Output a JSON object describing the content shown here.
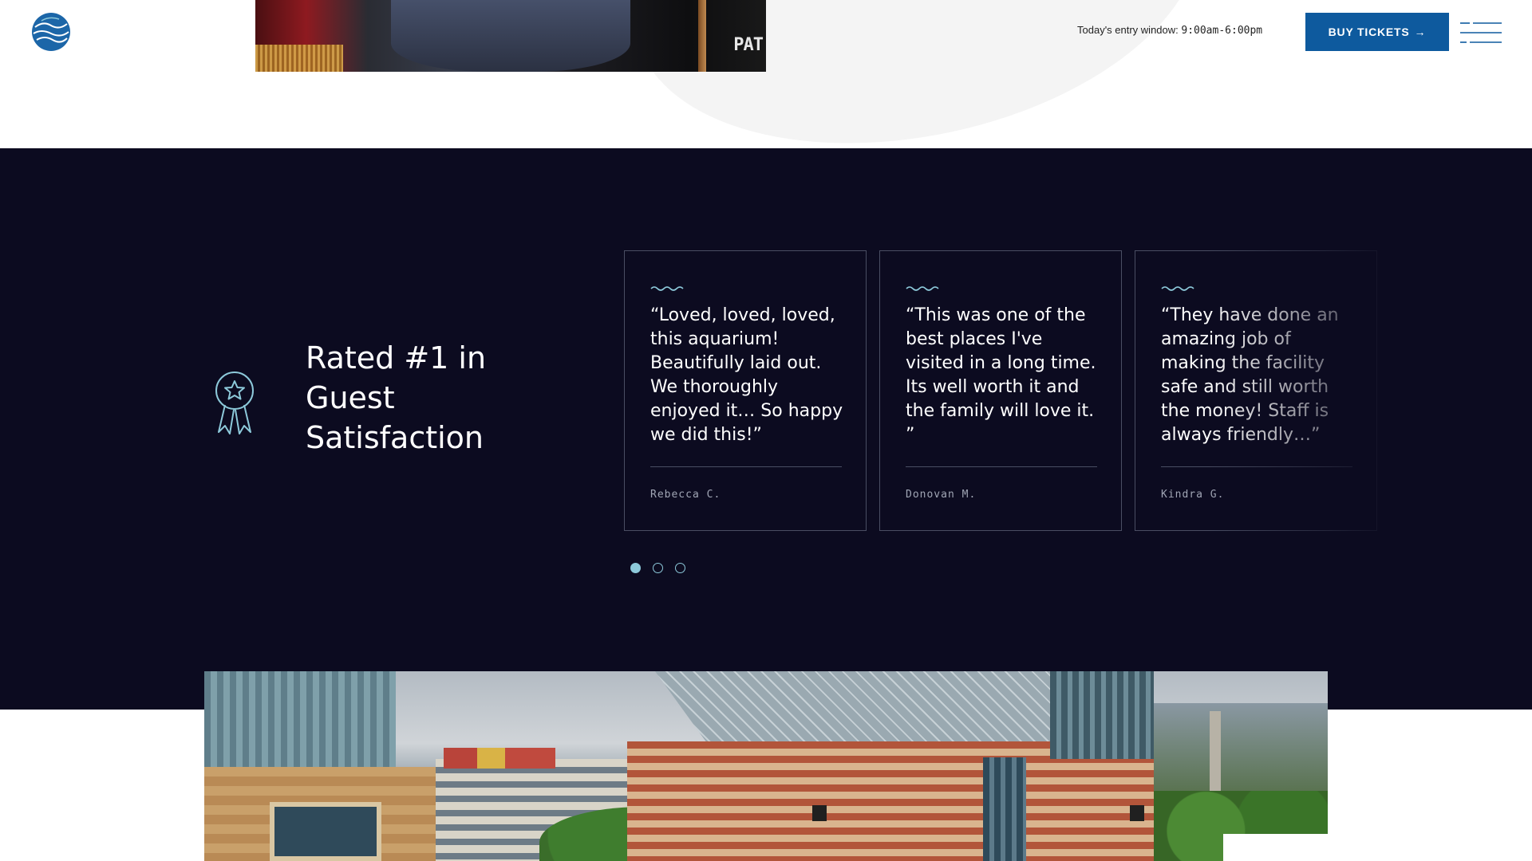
{
  "header": {
    "entry_label": "Today's entry window: ",
    "entry_hours": "9:00am-6:00pm",
    "buy_tickets_label": "BUY TICKETS",
    "buy_tickets_arrow": "→",
    "photo_sign_text": "PAT"
  },
  "rated": {
    "title": "Rated #1 in Guest Satisfaction"
  },
  "testimonials": [
    {
      "quote": "“Loved, loved, loved, this aquarium! Beautifully laid out. We thoroughly enjoyed it… So happy we did this!”",
      "author": "Rebecca C."
    },
    {
      "quote": "“This was one of the best places I've visited in a long time. Its well worth it and the family will love it. ”",
      "author": "Donovan M."
    },
    {
      "quote": "“They have done an amazing job of making the facility safe and still worth the money! Staff is always friendly…”",
      "author": "Kindra G."
    }
  ],
  "carousel": {
    "active_index": 0,
    "count": 3
  },
  "colors": {
    "brand_blue": "#0e5a9e",
    "dark_band": "#0c0b20",
    "accent_teal": "#8dc9da"
  },
  "icons": {
    "logo": "globe-wave-logo",
    "menu": "hamburger-menu-icon",
    "award": "award-ribbon-star-icon",
    "card_divider": "wave-icon"
  }
}
